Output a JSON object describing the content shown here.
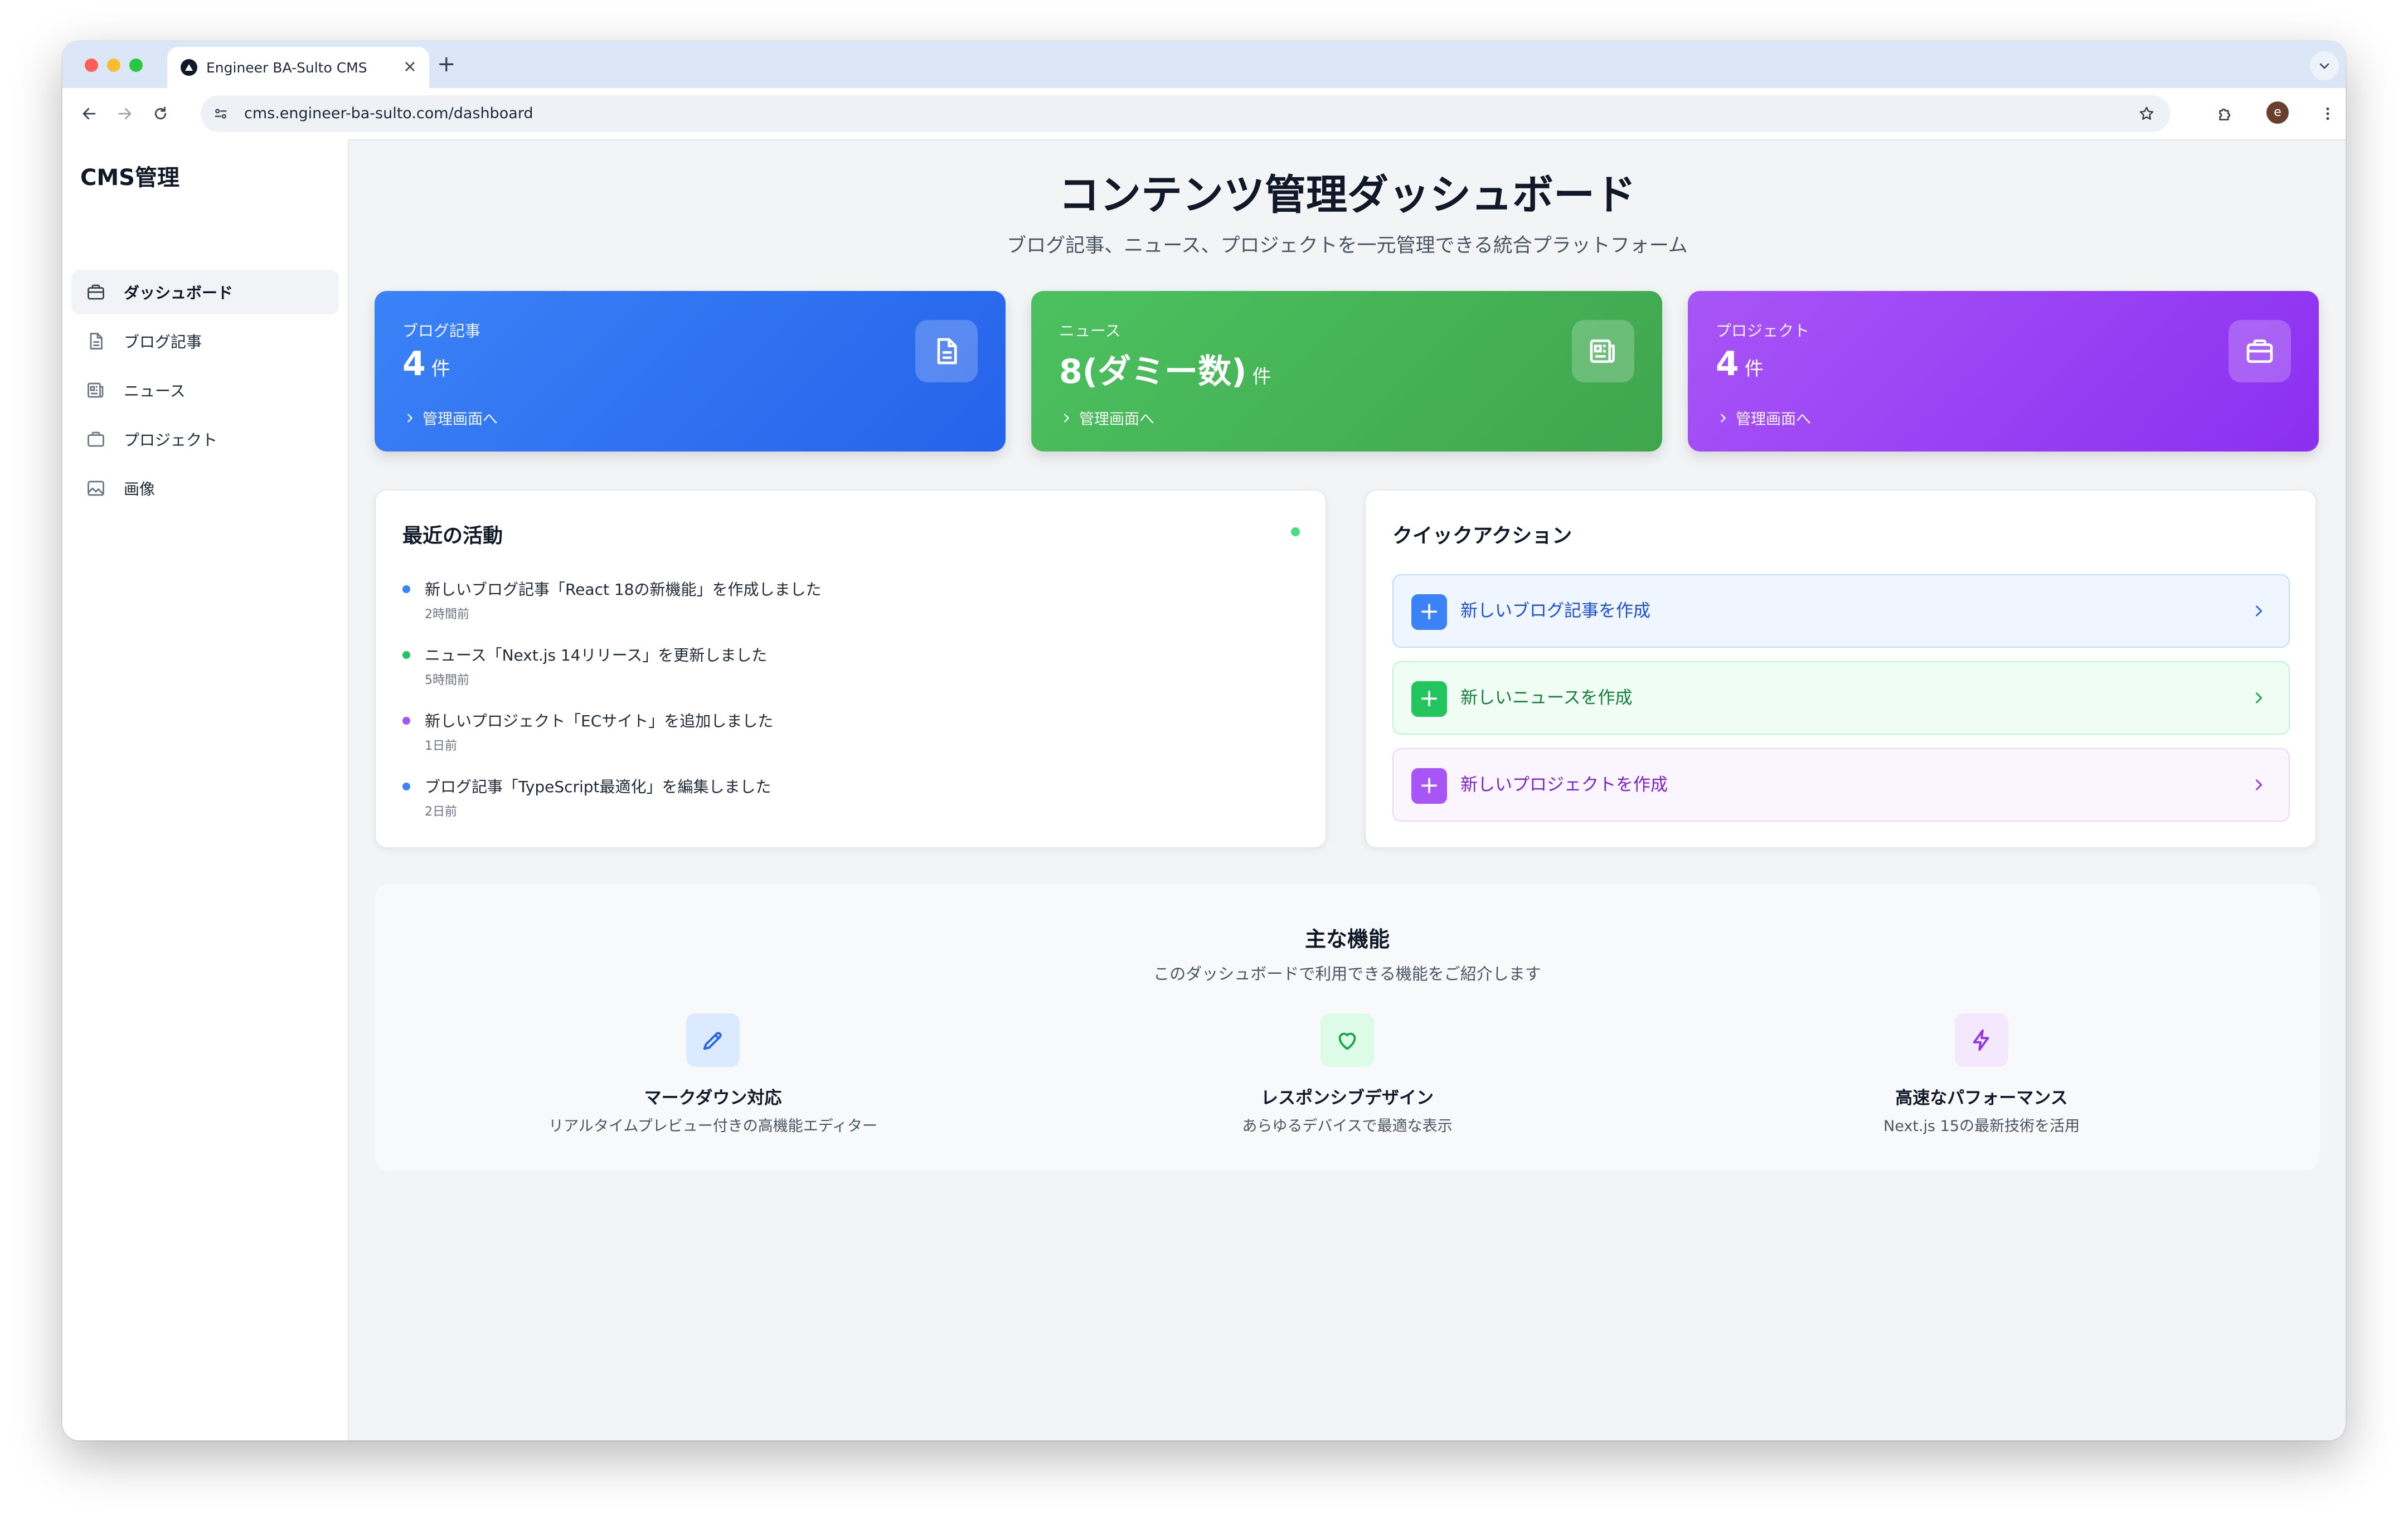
{
  "browser": {
    "tab_title": "Engineer BA-Sulto CMS",
    "tab_close": "×",
    "new_tab": "+",
    "url": "cms.engineer-ba-sulto.com/dashboard",
    "avatar_initial": "e"
  },
  "sidebar": {
    "title": "CMS管理",
    "items": [
      {
        "label": "ダッシュボード",
        "icon": "briefcase-icon",
        "active": true
      },
      {
        "label": "ブログ記事",
        "icon": "document-icon",
        "active": false
      },
      {
        "label": "ニュース",
        "icon": "newspaper-icon",
        "active": false
      },
      {
        "label": "プロジェクト",
        "icon": "folder-icon",
        "active": false
      },
      {
        "label": "画像",
        "icon": "image-icon",
        "active": false
      }
    ]
  },
  "header": {
    "title": "コンテンツ管理ダッシュボード",
    "subtitle": "ブログ記事、ニュース、プロジェクトを一元管理できる統合プラットフォーム"
  },
  "stats": [
    {
      "label": "ブログ記事",
      "value": "4",
      "unit": "件",
      "link": "管理画面へ",
      "icon": "document-icon",
      "color_from": "#3b82f6",
      "color_to": "#2563eb"
    },
    {
      "label": "ニュース",
      "value": "8(ダミー数)",
      "unit": "件",
      "link": "管理画面へ",
      "icon": "newspaper-icon",
      "color_from": "#4cc15f",
      "color_to": "#3fa64e"
    },
    {
      "label": "プロジェクト",
      "value": "4",
      "unit": "件",
      "link": "管理画面へ",
      "icon": "briefcase-icon",
      "color_from": "#a855f7",
      "color_to": "#8b2ff0"
    }
  ],
  "recent": {
    "title": "最近の活動",
    "items": [
      {
        "text": "新しいブログ記事「React 18の新機能」を作成しました",
        "time": "2時間前",
        "color": "#3b82f6"
      },
      {
        "text": "ニュース「Next.js 14リリース」を更新しました",
        "time": "5時間前",
        "color": "#22c55e"
      },
      {
        "text": "新しいプロジェクト「ECサイト」を追加しました",
        "time": "1日前",
        "color": "#a855f7"
      },
      {
        "text": "ブログ記事「TypeScript最適化」を編集しました",
        "time": "2日前",
        "color": "#3b82f6"
      }
    ]
  },
  "quick": {
    "title": "クイックアクション",
    "plus": "+",
    "items": [
      {
        "label": "新しいブログ記事を作成",
        "bg": "#eff6ff",
        "border": "#bfdbfe",
        "accent": "#3b82f6",
        "text": "#1d4ed8"
      },
      {
        "label": "新しいニュースを作成",
        "bg": "#f0fdf4",
        "border": "#bbf7d0",
        "accent": "#22c55e",
        "text": "#15803d"
      },
      {
        "label": "新しいプロジェクトを作成",
        "bg": "#faf5ff",
        "border": "#e9d5ff",
        "accent": "#a855f7",
        "text": "#7e22ce"
      }
    ]
  },
  "features": {
    "title": "主な機能",
    "subtitle": "このダッシュボードで利用できる機能をご紹介します",
    "items": [
      {
        "name": "マークダウン対応",
        "desc": "リアルタイムプレビュー付きの高機能エディター",
        "icon": "pencil-icon",
        "bg": "#dbeafe",
        "color": "#2563eb"
      },
      {
        "name": "レスポンシブデザイン",
        "desc": "あらゆるデバイスで最適な表示",
        "icon": "heart-icon",
        "bg": "#dcfce7",
        "color": "#16a34a"
      },
      {
        "name": "高速なパフォーマンス",
        "desc": "Next.js 15の最新技術を活用",
        "icon": "lightning-icon",
        "bg": "#f3e8ff",
        "color": "#9333ea"
      }
    ]
  }
}
